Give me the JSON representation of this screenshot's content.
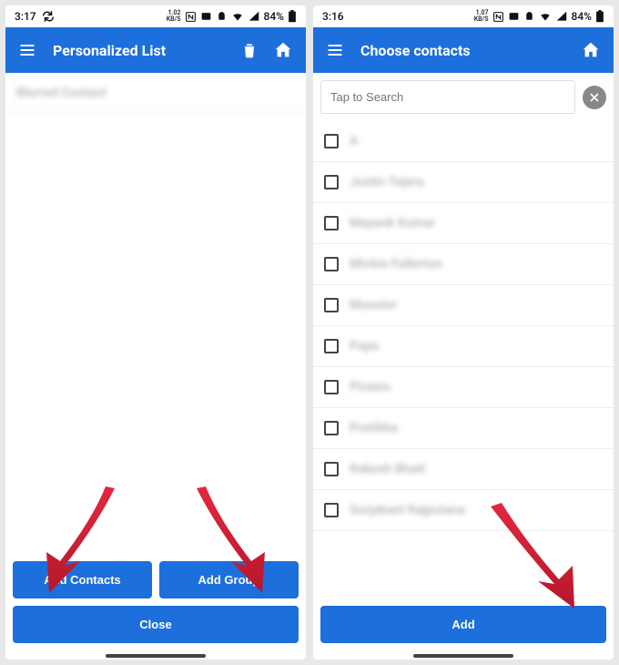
{
  "colors": {
    "brand": "#1d6fdc"
  },
  "left": {
    "status": {
      "time": "3:17",
      "net": "1.02\nKB/S",
      "battery": "84%"
    },
    "title": "Personalized List",
    "entry": "Blurred Contact",
    "buttons": {
      "add_contacts": "Add Contacts",
      "add_group": "Add Group",
      "close": "Close"
    }
  },
  "right": {
    "status": {
      "time": "3:16",
      "net": "1.07\nKB/S",
      "battery": "84%"
    },
    "title": "Choose contacts",
    "search_placeholder": "Tap to Search",
    "contacts": [
      "A",
      "Justin Tejera",
      "Mayank Kumar",
      "Mickie Fullerton",
      "Munster",
      "Papa",
      "Pirates",
      "Pratibha",
      "Rakesh Bhatt",
      "Surjakant Rajputana"
    ],
    "add_button": "Add"
  }
}
